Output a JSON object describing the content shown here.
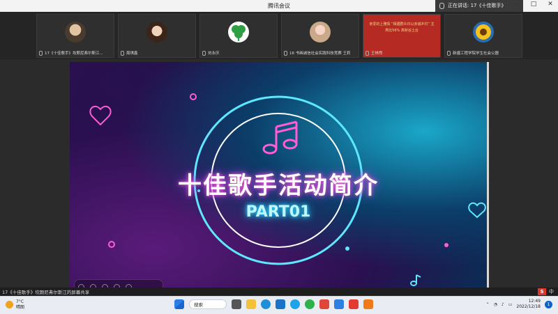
{
  "window": {
    "title": "腾讯会议",
    "speaking": "正在讲话: 17《十佳歌手》"
  },
  "participants": [
    {
      "name": "17《十佳歌手》坎朗尼弗尔斯江..."
    },
    {
      "name": "周琪鑫"
    },
    {
      "name": "刘永庆"
    },
    {
      "name": "16 书画诚信社会实践科技竞赛 王莉"
    },
    {
      "name": "王林然",
      "slide_text": "亲爱的上雅情 “相遇群众日以赤诚乡村” 主类比56% 高秋谷土台"
    },
    {
      "name": "新疆工程学院学生社会公器"
    }
  ],
  "slide": {
    "title": "十佳歌手活动简介",
    "subtitle": "PART01"
  },
  "share": {
    "label": "17《十佳歌手》坎朗尼弗尔斯江的屏幕共享"
  },
  "ime": {
    "brand": "S",
    "mode": "中"
  },
  "taskbar": {
    "temp": "7°C",
    "weather": "晴朗",
    "search": "搜索",
    "time": "12:49",
    "date": "2022/12/18",
    "notif": "1"
  },
  "colors": {
    "accent": "#b52a22",
    "slide_glow_pink": "#ff5cd6",
    "slide_glow_cyan": "#29d6ff"
  }
}
